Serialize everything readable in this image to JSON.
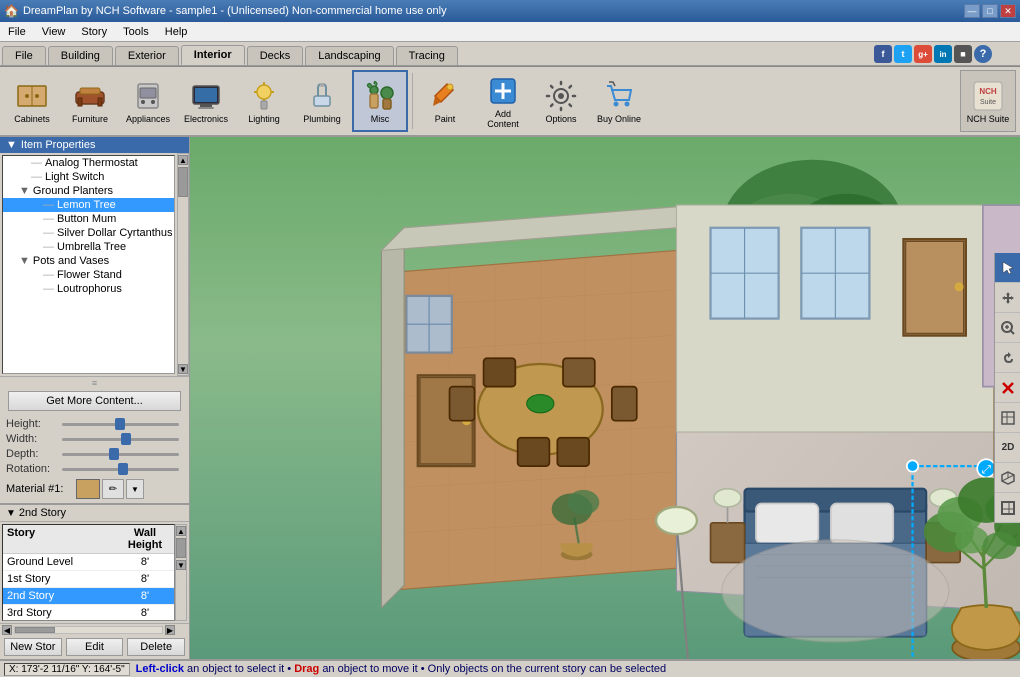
{
  "titleBar": {
    "title": "DreamPlan by NCH Software - sample1 - (Unlicensed) Non-commercial home use only",
    "icon": "🏠",
    "controls": [
      "—",
      "□",
      "✕"
    ]
  },
  "menuBar": {
    "items": [
      "File",
      "View",
      "Story",
      "Tools",
      "Help"
    ]
  },
  "tabs": [
    {
      "label": "File",
      "active": false
    },
    {
      "label": "Building",
      "active": false
    },
    {
      "label": "Exterior",
      "active": false
    },
    {
      "label": "Interior",
      "active": true
    },
    {
      "label": "Decks",
      "active": false
    },
    {
      "label": "Landscaping",
      "active": false
    },
    {
      "label": "Tracing",
      "active": false
    }
  ],
  "toolbar": {
    "buttons": [
      {
        "label": "Cabinets",
        "icon": "cabinet"
      },
      {
        "label": "Furniture",
        "icon": "furniture"
      },
      {
        "label": "Appliances",
        "icon": "appliances"
      },
      {
        "label": "Electronics",
        "icon": "electronics"
      },
      {
        "label": "Lighting",
        "icon": "lighting"
      },
      {
        "label": "Plumbing",
        "icon": "plumbing"
      },
      {
        "label": "Misc",
        "icon": "misc",
        "active": true
      },
      {
        "label": "Paint",
        "icon": "paint"
      },
      {
        "label": "Add Content",
        "icon": "add-content"
      },
      {
        "label": "Options",
        "icon": "options"
      },
      {
        "label": "Buy Online",
        "icon": "buy-online"
      }
    ],
    "nchSuite": "NCH Suite"
  },
  "itemProperties": {
    "title": "Item Properties",
    "treeItems": [
      {
        "label": "Analog Thermostat",
        "indent": 2,
        "type": "item"
      },
      {
        "label": "Light Switch",
        "indent": 2,
        "type": "item"
      },
      {
        "label": "Ground Planters",
        "indent": 1,
        "type": "group",
        "expanded": true
      },
      {
        "label": "Lemon Tree",
        "indent": 3,
        "type": "item",
        "selected": true
      },
      {
        "label": "Button Mum",
        "indent": 3,
        "type": "item"
      },
      {
        "label": "Silver Dollar Cyrtanthus",
        "indent": 3,
        "type": "item"
      },
      {
        "label": "Umbrella Tree",
        "indent": 3,
        "type": "item"
      },
      {
        "label": "Pots and Vases",
        "indent": 1,
        "type": "group",
        "expanded": true
      },
      {
        "label": "Flower Stand",
        "indent": 3,
        "type": "item"
      },
      {
        "label": "Loutrophorus",
        "indent": 3,
        "type": "item"
      }
    ],
    "getMoreBtn": "Get More Content...",
    "sliders": [
      {
        "label": "Height:",
        "value": 50
      },
      {
        "label": "Width:",
        "value": 55
      },
      {
        "label": "Depth:",
        "value": 45
      },
      {
        "label": "Rotation:",
        "value": 50
      }
    ],
    "material": {
      "label": "Material #1:",
      "color": "#c8a060"
    }
  },
  "storyPanel": {
    "title": "2nd Story",
    "columns": [
      "Story",
      "Wall Height"
    ],
    "rows": [
      {
        "story": "Ground Level",
        "height": "8'"
      },
      {
        "story": "1st Story",
        "height": "8'"
      },
      {
        "story": "2nd Story",
        "height": "8'",
        "active": true
      },
      {
        "story": "3rd Story",
        "height": "8'"
      }
    ],
    "buttons": [
      "New Stor",
      "Edit",
      "Delete"
    ],
    "storyLabels": {
      "story1": "Story",
      "story2": "Story"
    }
  },
  "statusBar": {
    "coords": "X: 173'-2 11/16\"  Y: 164'-5\"",
    "message": "Left-click an object to select it • Drag an object to move it • Only objects on the current story can be selected"
  },
  "rightToolbar": {
    "buttons": [
      {
        "icon": "👆",
        "tooltip": "Select",
        "active": true
      },
      {
        "icon": "✋",
        "tooltip": "Pan"
      },
      {
        "icon": "🔍",
        "tooltip": "Zoom"
      },
      {
        "icon": "↺",
        "tooltip": "Rotate"
      },
      {
        "icon": "✕",
        "tooltip": "Delete",
        "color": "red"
      },
      {
        "icon": "⊞",
        "tooltip": "Grid"
      },
      {
        "icon": "2D",
        "tooltip": "2D View"
      },
      {
        "icon": "◉",
        "tooltip": "3D View"
      },
      {
        "icon": "⊟",
        "tooltip": "Floor Plan"
      }
    ]
  },
  "social": {
    "buttons": [
      {
        "label": "f",
        "color": "#3b5998"
      },
      {
        "label": "t",
        "color": "#1da1f2"
      },
      {
        "label": "g+",
        "color": "#dd4b39"
      },
      {
        "label": "in",
        "color": "#0077b5"
      },
      {
        "label": "■",
        "color": "#333"
      }
    ]
  }
}
